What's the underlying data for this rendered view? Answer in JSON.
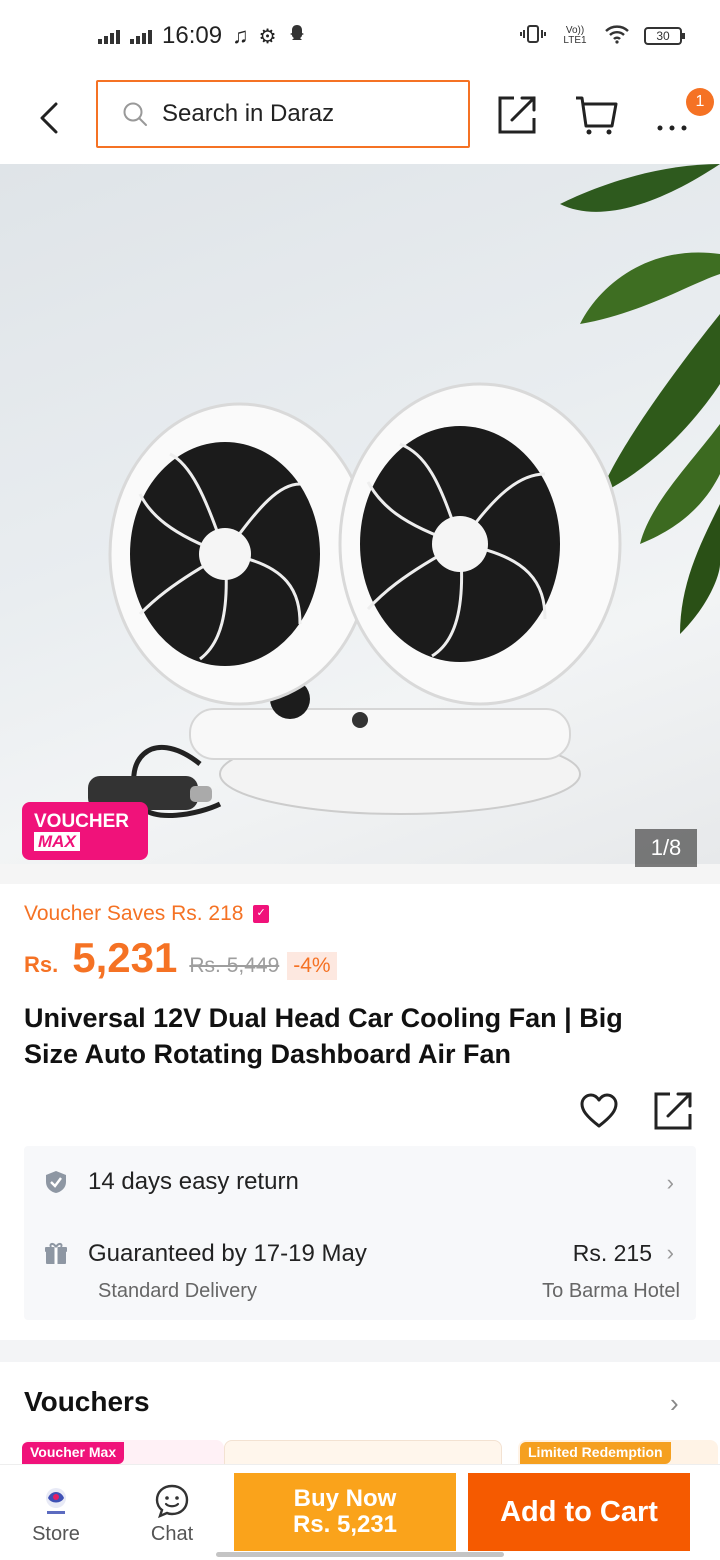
{
  "status_bar": {
    "time": "16:09",
    "battery": "30",
    "network": "Vo)) LTE1"
  },
  "header": {
    "search_placeholder": "Search in Daraz",
    "notification_count": "1",
    "icons": [
      "back-arrow-icon",
      "search-icon",
      "share-icon",
      "cart-icon",
      "more-icon"
    ]
  },
  "gallery": {
    "counter": "1/8",
    "badge_line1": "VOUCHER",
    "badge_line2": "MAX"
  },
  "price": {
    "voucher_saves": "Voucher Saves Rs. 218",
    "currency": "Rs.",
    "current": "5,231",
    "original": "Rs. 5,449",
    "discount": "-4%"
  },
  "product": {
    "title": "Universal 12V Dual Head Car Cooling Fan | Big Size Auto Rotating Dashboard Air Fan"
  },
  "services": {
    "return_label": "14 days easy return",
    "delivery_label": "Guaranteed by 17-19 May",
    "delivery_type": "Standard Delivery",
    "delivery_fee": "Rs. 215",
    "delivery_location": "To Barma Hotel"
  },
  "vouchers": {
    "heading": "Vouchers",
    "tags": [
      "Voucher Max",
      "Limited Redemption"
    ]
  },
  "bottom_bar": {
    "store_label": "Store",
    "chat_label": "Chat",
    "buy_now_line1": "Buy Now",
    "buy_now_line2": "Rs. 5,231",
    "add_to_cart": "Add to Cart"
  },
  "colors": {
    "accent": "#f57224",
    "buy_now": "#faa31b",
    "add_to_cart": "#f55a00",
    "voucher_pink": "#f0127a"
  }
}
